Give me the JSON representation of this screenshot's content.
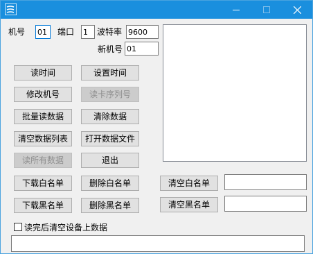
{
  "window": {
    "minimize_icon": "minimize-icon",
    "maximize_icon": "maximize-icon",
    "close_icon": "close-icon",
    "app_icon": "app-logo-icon",
    "titlebar_color": "#1a8fde"
  },
  "settings": {
    "machine_no_label": "机号",
    "machine_no_value": "01",
    "port_label": "端口",
    "port_value": "1",
    "baud_label": "波特率",
    "baud_value": "9600",
    "new_machine_no_label": "新机号",
    "new_machine_no_value": "01"
  },
  "buttons": {
    "read_time": "读时间",
    "set_time": "设置时间",
    "change_machine_no": "修改机号",
    "read_card_serial": "读卡序列号",
    "batch_read": "批量读数据",
    "clear_data": "清除数据",
    "clear_data_list": "清空数据列表",
    "open_data_file": "打开数据文件",
    "read_all_data": "读所有数据",
    "exit": "退出",
    "download_whitelist": "下载白名单",
    "delete_whitelist": "删除白名单",
    "clear_whitelist": "清空白名单",
    "download_blacklist": "下载黑名单",
    "delete_blacklist": "删除黑名单",
    "clear_blacklist": "清空黑名单"
  },
  "whitelist_value": "",
  "blacklist_value": "",
  "clear_after_read": {
    "label": "读完后清空设备上数据",
    "checked": false
  },
  "status_text": ""
}
